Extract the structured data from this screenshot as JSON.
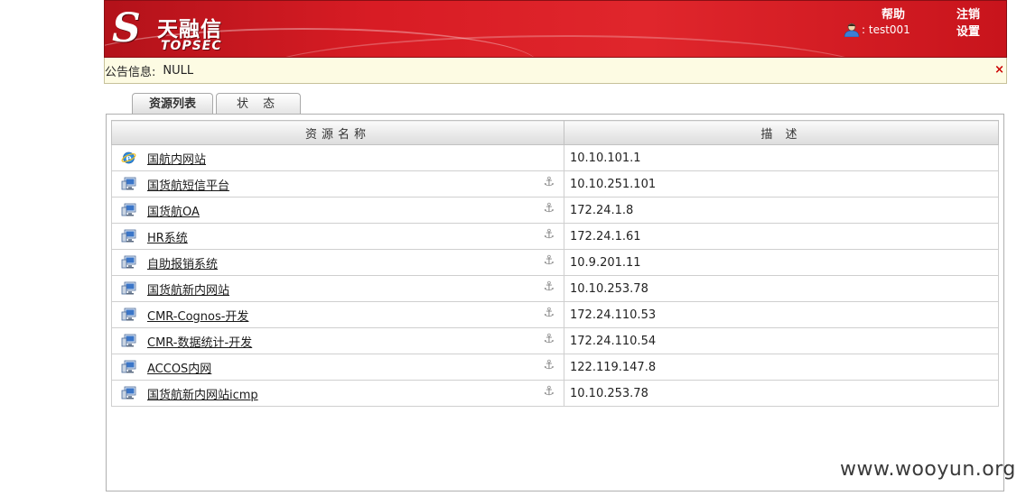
{
  "header": {
    "logo_cn": "天融信",
    "logo_en": "TOPSEC",
    "help": "帮助",
    "logout": "注销",
    "settings": "设置",
    "username": ": test001"
  },
  "notice": {
    "label": "公告信息:",
    "value": "NULL",
    "close": "×"
  },
  "tabs": [
    {
      "label": "资源列表",
      "active": true
    },
    {
      "label": "状 态",
      "active": false
    }
  ],
  "table": {
    "columns": [
      "资源名称",
      "描 述"
    ],
    "rows": [
      {
        "name": "国航内网站",
        "desc": "10.10.101.1",
        "icon": "ie-browser-icon",
        "anchor": false
      },
      {
        "name": "国货航短信平台",
        "desc": "10.10.251.101",
        "icon": "computer-icon",
        "anchor": true
      },
      {
        "name": "国货航OA",
        "desc": "172.24.1.8",
        "icon": "computer-icon",
        "anchor": true
      },
      {
        "name": "HR系统",
        "desc": "172.24.1.61",
        "icon": "computer-icon",
        "anchor": true
      },
      {
        "name": "自助报销系统",
        "desc": "10.9.201.11",
        "icon": "computer-icon",
        "anchor": true
      },
      {
        "name": "国货航新内网站",
        "desc": "10.10.253.78",
        "icon": "computer-icon",
        "anchor": true
      },
      {
        "name": "CMR-Cognos-开发",
        "desc": "172.24.110.53",
        "icon": "computer-icon",
        "anchor": true
      },
      {
        "name": "CMR-数据统计-开发",
        "desc": "172.24.110.54",
        "icon": "computer-icon",
        "anchor": true
      },
      {
        "name": "ACCOS内网",
        "desc": "122.119.147.8",
        "icon": "computer-icon",
        "anchor": true
      },
      {
        "name": "国货航新内网站icmp",
        "desc": "10.10.253.78",
        "icon": "computer-icon",
        "anchor": true
      }
    ]
  },
  "watermark": "www.wooyun.org",
  "colors": {
    "header_red": "#d81c24",
    "notice_bg": "#fdfbe3",
    "close_red": "#cc0000"
  }
}
